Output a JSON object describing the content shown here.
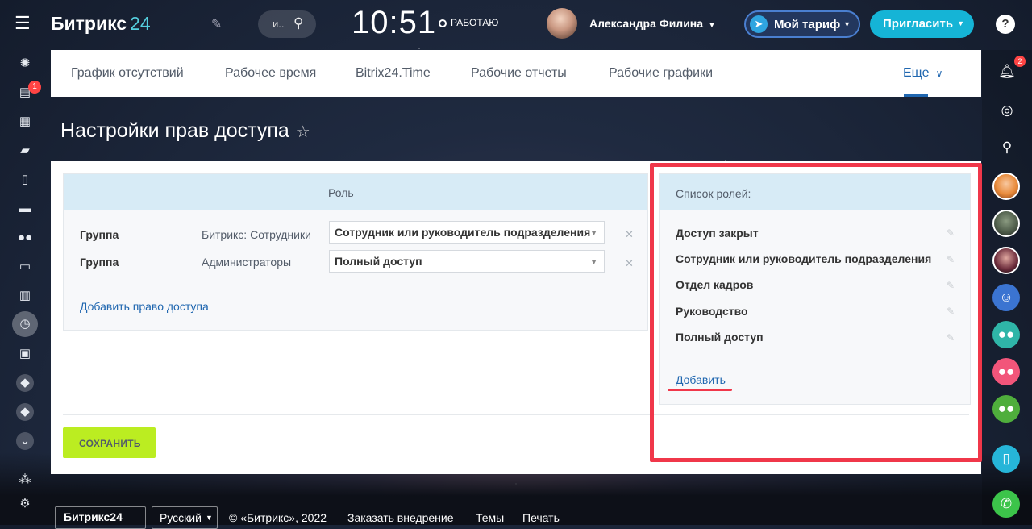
{
  "topbar": {
    "logo_text": "Битрикс",
    "logo_num": "24",
    "search_placeholder": "и..",
    "clock": "10:51",
    "work_status": "РАБОТАЮ",
    "user_name": "Александра Филина",
    "tariff_label": "Мой тариф",
    "invite_label": "Пригласить",
    "help_glyph": "?"
  },
  "left_sidebar": {
    "notification_count": "1"
  },
  "tabs": [
    {
      "label": "График отсутствий"
    },
    {
      "label": "Рабочее время"
    },
    {
      "label": "Bitrix24.Time"
    },
    {
      "label": "Рабочие отчеты"
    },
    {
      "label": "Рабочие графики"
    }
  ],
  "tabs_more": "Еще",
  "page_title": "Настройки прав доступа",
  "permissions": {
    "header": "Роль",
    "rows": [
      {
        "kind": "Группа",
        "name": "Битрикс: Сотрудники",
        "role": "Сотрудник или руководитель подразделения"
      },
      {
        "kind": "Группа",
        "name": "Администраторы",
        "role": "Полный доступ"
      }
    ],
    "add_link": "Добавить право доступа"
  },
  "roles": {
    "header": "Список ролей:",
    "items": [
      "Доступ закрыт",
      "Сотрудник или руководитель подразделения",
      "Отдел кадров",
      "Руководство",
      "Полный доступ"
    ],
    "add_link": "Добавить"
  },
  "save_label": "СОХРАНИТЬ",
  "footer": {
    "logo": "Битрикс24",
    "lang": "Русский",
    "copyright": "© «Битрикс», 2022",
    "order": "Заказать внедрение",
    "themes": "Темы",
    "print": "Печать"
  },
  "right_sidebar": {
    "notification_count": "2"
  },
  "colors": {
    "accent_blue": "#2067b0",
    "invite": "#15b4d6",
    "save": "#bbed21",
    "highlight": "#f0374a"
  }
}
